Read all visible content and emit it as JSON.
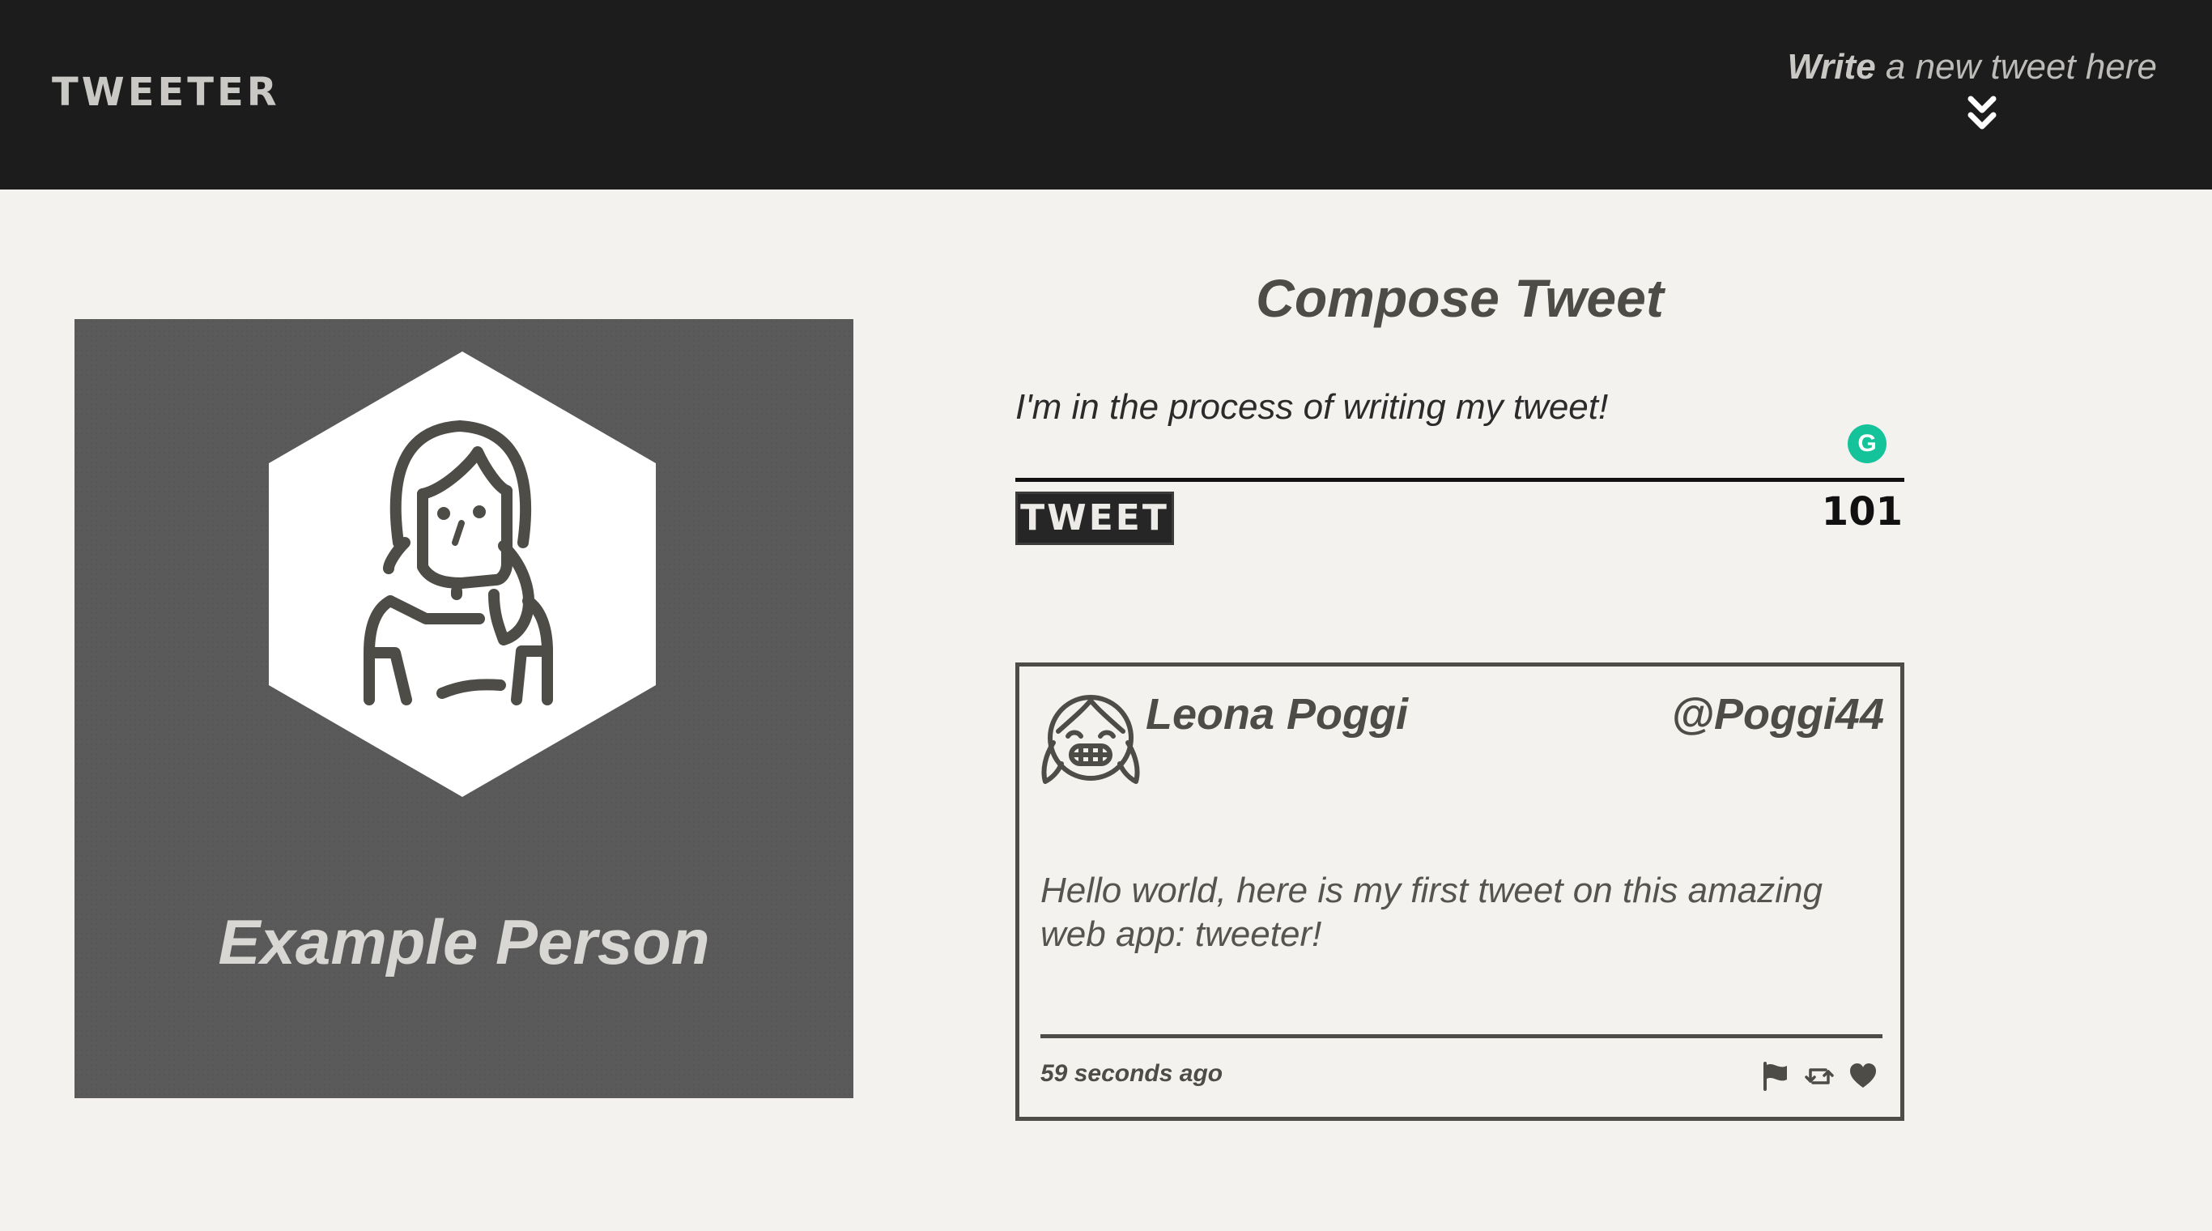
{
  "nav": {
    "logo": "TWEETER",
    "write_bold": "Write",
    "write_rest": " a new tweet here",
    "chevron_icon": "double-chevron-down-icon"
  },
  "profile": {
    "name": "Example Person",
    "avatar_icon": "user-avatar-icon"
  },
  "compose": {
    "title": "Compose Tweet",
    "text": "I'm in the process of writing my tweet!",
    "grammarly_glyph": "G",
    "button_label": "TWEET",
    "counter": "101"
  },
  "tweet": {
    "name": "Leona Poggi",
    "handle": "@Poggi44",
    "body": "Hello world, here is my first tweet on this amazing web app: tweeter!",
    "time": "59 seconds ago",
    "icons": [
      "flag-icon",
      "retweet-icon",
      "heart-icon"
    ]
  },
  "colors": {
    "header_bg": "#1c1c1c",
    "page_bg": "#f3f2ee",
    "card_bg": "#5a5a5a",
    "text": "#4d4c47",
    "grammarly": "#15c39a"
  }
}
